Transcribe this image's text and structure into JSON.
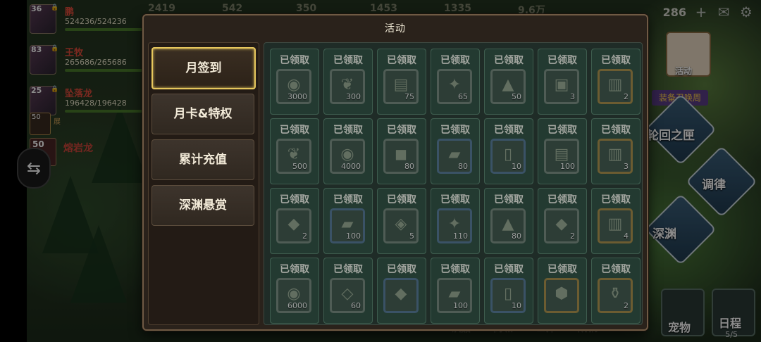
{
  "background": {
    "top_resources": [
      "2419",
      "542",
      "350",
      "1453",
      "1335",
      "9.6万"
    ],
    "gem_count": "286",
    "heroes": [
      {
        "level": "36",
        "name": "鹏",
        "hp": "524236/524236"
      },
      {
        "level": "83",
        "name": "王牧",
        "hp": "265686/265686"
      },
      {
        "level": "25",
        "name": "坠落龙",
        "hp": "196428/196428"
      }
    ],
    "small_hero": {
      "level": "50",
      "tag": "展"
    },
    "dragon": {
      "level": "50",
      "name": "熔岩龙"
    },
    "side_buttons": {
      "event": "活动",
      "banner": "装备召唤周",
      "diamond1": "轮回之匣",
      "diamond2": "调律",
      "diamond3": "深渊"
    },
    "bottom": {
      "menu": [
        "饮品",
        "商城",
        "世界",
        "成就"
      ],
      "pet": "宠物",
      "schedule": "日程",
      "schedule_count": "5/5"
    }
  },
  "modal": {
    "title": "活动",
    "tabs": [
      {
        "label": "月签到",
        "active": true
      },
      {
        "label": "月卡&特权",
        "active": false
      },
      {
        "label": "累计充值",
        "active": false
      },
      {
        "label": "深渊悬赏",
        "active": false
      }
    ],
    "rows": [
      [
        {
          "status": "已领取",
          "icon": "coin-icon",
          "qty": "3000",
          "frame": "gray"
        },
        {
          "status": "已领取",
          "icon": "wheat-icon",
          "qty": "300",
          "frame": "gray"
        },
        {
          "status": "已领取",
          "icon": "log-icon",
          "qty": "75",
          "frame": "gray"
        },
        {
          "status": "已领取",
          "icon": "crystal-icon",
          "qty": "65",
          "frame": "gray"
        },
        {
          "status": "已领取",
          "icon": "ore-pile-icon",
          "qty": "50",
          "frame": "gray"
        },
        {
          "status": "已领取",
          "icon": "gift-box-icon",
          "qty": "3",
          "frame": "gray"
        },
        {
          "status": "已领取",
          "icon": "scroll-icon",
          "qty": "2",
          "frame": "gold"
        }
      ],
      [
        {
          "status": "已领取",
          "icon": "wheat-icon",
          "qty": "500",
          "frame": "gray"
        },
        {
          "status": "已领取",
          "icon": "coin-icon",
          "qty": "4000",
          "frame": "gray"
        },
        {
          "status": "已领取",
          "icon": "iron-ore-icon",
          "qty": "80",
          "frame": "gray"
        },
        {
          "status": "已领取",
          "icon": "ingot-icon",
          "qty": "80",
          "frame": "blue"
        },
        {
          "status": "已领取",
          "icon": "bucket-icon",
          "qty": "10",
          "frame": "blue"
        },
        {
          "status": "已领取",
          "icon": "log-icon",
          "qty": "100",
          "frame": "gray"
        },
        {
          "status": "已领取",
          "icon": "scroll-icon",
          "qty": "3",
          "frame": "gold"
        }
      ],
      [
        {
          "status": "已领取",
          "icon": "mystery-crystal-icon",
          "qty": "2",
          "frame": "gray"
        },
        {
          "status": "已领取",
          "icon": "ingot-icon",
          "qty": "100",
          "frame": "blue"
        },
        {
          "status": "已领取",
          "icon": "gem-icon",
          "qty": "5",
          "frame": "gray"
        },
        {
          "status": "已领取",
          "icon": "crystal-icon",
          "qty": "110",
          "frame": "blue"
        },
        {
          "status": "已领取",
          "icon": "ore-pile-icon",
          "qty": "80",
          "frame": "gray"
        },
        {
          "status": "已领取",
          "icon": "mystery-crystal-icon",
          "qty": "2",
          "frame": "gray"
        },
        {
          "status": "已领取",
          "icon": "scroll-icon",
          "qty": "4",
          "frame": "gold"
        }
      ],
      [
        {
          "status": "已领取",
          "icon": "coin-icon",
          "qty": "6000",
          "frame": "gray"
        },
        {
          "status": "已领取",
          "icon": "diamond-icon",
          "qty": "60",
          "frame": "gray"
        },
        {
          "status": "已领取",
          "icon": "mystery-crystal-icon",
          "qty": "",
          "frame": "blue"
        },
        {
          "status": "已领取",
          "icon": "ingot-icon",
          "qty": "100",
          "frame": "gray"
        },
        {
          "status": "已领取",
          "icon": "bucket-icon",
          "qty": "10",
          "frame": "blue"
        },
        {
          "status": "已领取",
          "icon": "stone-icon",
          "qty": "",
          "frame": "gold"
        },
        {
          "status": "已领取",
          "icon": "potion-icon",
          "qty": "2",
          "frame": "gold"
        }
      ]
    ]
  }
}
